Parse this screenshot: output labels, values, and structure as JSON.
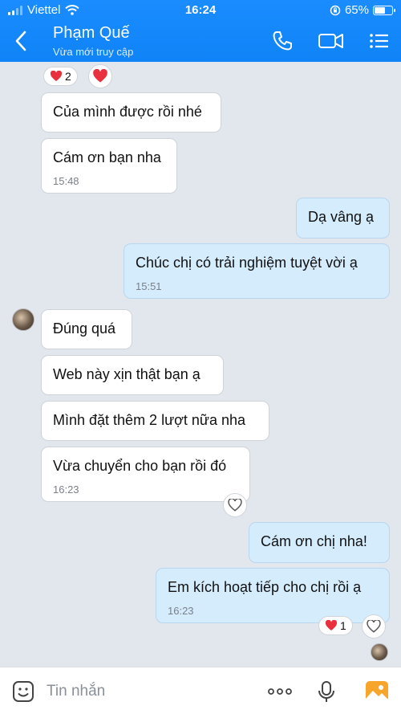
{
  "status_bar": {
    "carrier": "Viettel",
    "time": "16:24",
    "battery": "65%",
    "battery_level": 0.65
  },
  "header": {
    "name": "Phạm Quế",
    "presence": "Vừa mới truy cập"
  },
  "messages": [
    {
      "dir": "in",
      "text": "Của mình được rồi nhé"
    },
    {
      "dir": "in",
      "text": "Cám ơn bạn nha",
      "time": "15:48"
    },
    {
      "dir": "out",
      "text": "Dạ vâng ạ"
    },
    {
      "dir": "out",
      "text": "Chúc chị có trải nghiệm tuyệt vời ạ",
      "time": "15:51"
    },
    {
      "dir": "in",
      "text": "Đúng quá"
    },
    {
      "dir": "in",
      "text": "Web này xịn thật bạn ạ"
    },
    {
      "dir": "in",
      "text": "Mình đặt thêm 2 lượt nữa nha"
    },
    {
      "dir": "in",
      "text": "Vừa chuyển cho bạn rồi đó",
      "time": "16:23"
    },
    {
      "dir": "out",
      "text": "Cám ơn chị nha!"
    },
    {
      "dir": "out",
      "text": "Em kích hoạt tiếp cho chị rồi ạ",
      "time": "16:23"
    }
  ],
  "reactions": {
    "top_count": "2",
    "last_count": "1"
  },
  "input": {
    "placeholder": "Tin nhắn",
    "more": "ooo"
  },
  "colors": {
    "header": "#0f84f7",
    "outgoing_bubble": "#d5ecfd",
    "incoming_bubble": "#ffffff",
    "background": "#e2e6ed",
    "heart": "#e8303e"
  }
}
